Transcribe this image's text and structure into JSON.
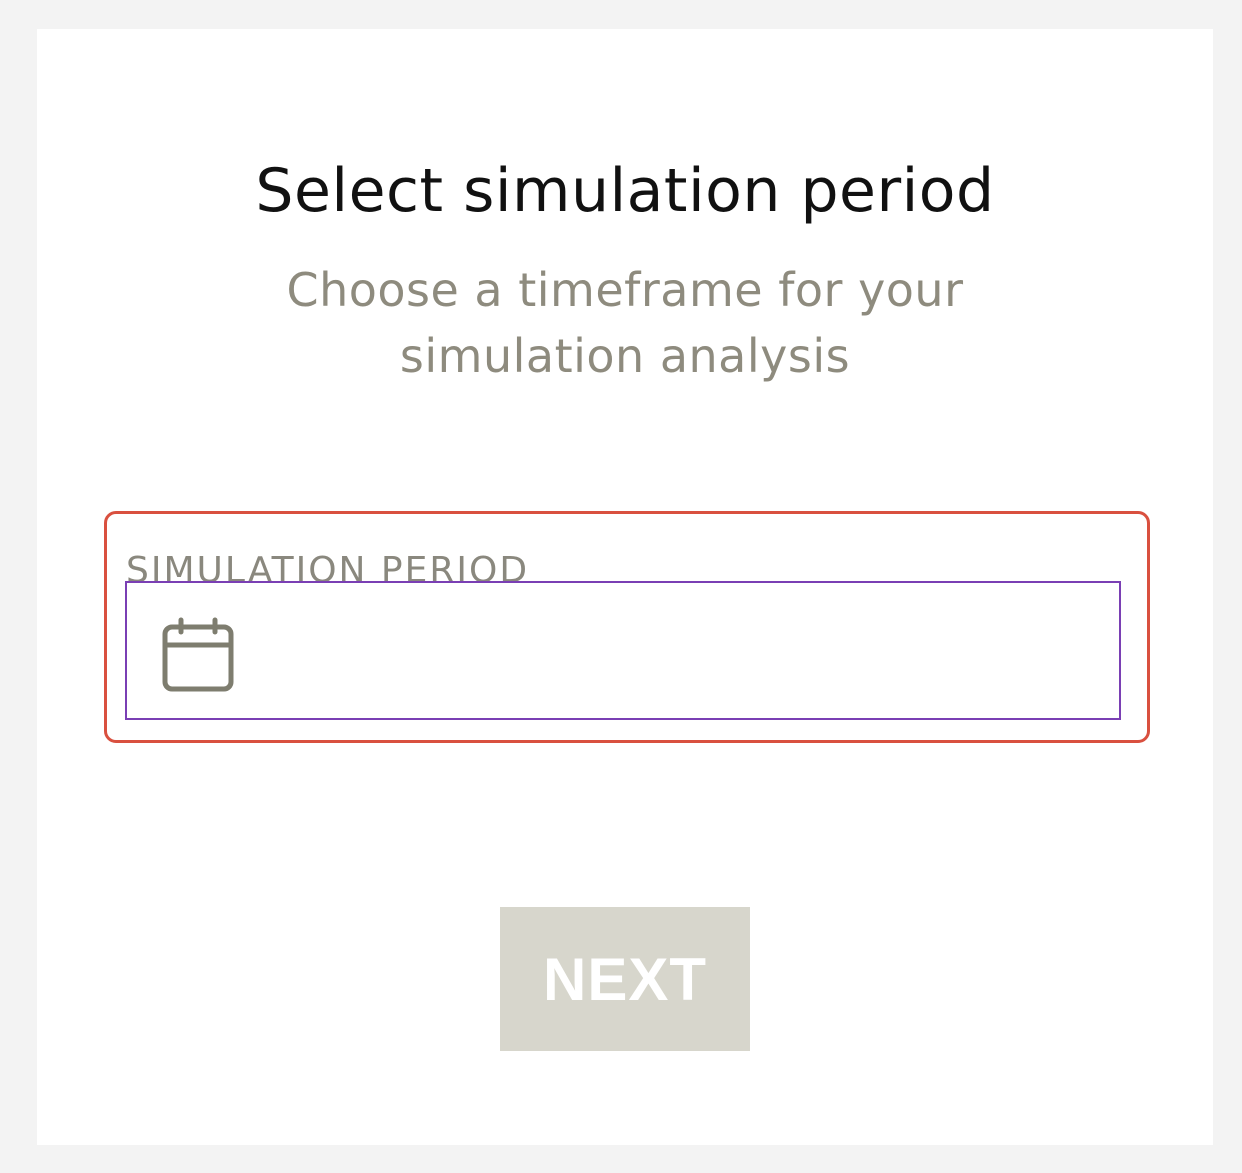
{
  "header": {
    "title": "Select simulation period",
    "subtitle": "Choose a timeframe for your simulation analysis"
  },
  "period_field": {
    "label": "SIMULATION PERIOD",
    "value": "",
    "icon": "calendar-icon"
  },
  "actions": {
    "next_label": "NEXT",
    "next_enabled": false
  },
  "colors": {
    "highlight_border": "#d9503f",
    "input_border_focus": "#7a3fb4",
    "button_disabled_bg": "#d7d6cc",
    "muted_text": "#8e8b7e"
  }
}
